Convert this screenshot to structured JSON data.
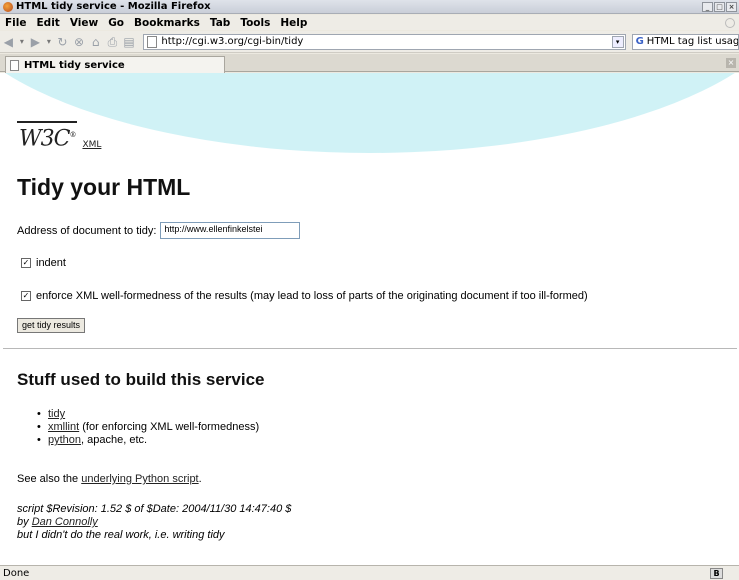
{
  "window": {
    "title": "HTML tidy service - Mozilla Firefox"
  },
  "menu": {
    "items": [
      "File",
      "Edit",
      "View",
      "Go",
      "Bookmarks",
      "Tab",
      "Tools",
      "Help"
    ]
  },
  "toolbar": {
    "url": "http://cgi.w3.org/cgi-bin/tidy",
    "search_text": "HTML tag list usage"
  },
  "tab": {
    "label": "HTML tidy service"
  },
  "page": {
    "logo_text": "W3C",
    "logo_mark": "®",
    "xml_link": "XML",
    "heading": "Tidy your HTML",
    "address_label": "Address of document to tidy:",
    "address_value": "http://www.ellenfinkelstei",
    "indent_label": "indent",
    "indent_checked": true,
    "enforce_label": "enforce XML well-formedness of the results (may lead to loss of parts of the originating document if too ill-formed)",
    "enforce_checked": true,
    "submit_label": "get tidy results",
    "stuff_heading": "Stuff used to build this service",
    "links": [
      {
        "link": "tidy",
        "rest": ""
      },
      {
        "link": "xmllint",
        "rest": " (for enforcing XML well-formedness)"
      },
      {
        "link": "python",
        "rest": ", apache, etc."
      }
    ],
    "see_also_prefix": "See also the ",
    "see_also_link": "underlying Python script",
    "see_also_suffix": ".",
    "sig_line1": "script $Revision: 1.52 $ of $Date: 2004/11/30 14:47:40 $",
    "sig_by": "by ",
    "sig_author": "Dan Connolly",
    "sig_line3": "but I didn't do the real work, i.e. writing tidy"
  },
  "status": {
    "text": "Done",
    "icon_letter": "B"
  }
}
